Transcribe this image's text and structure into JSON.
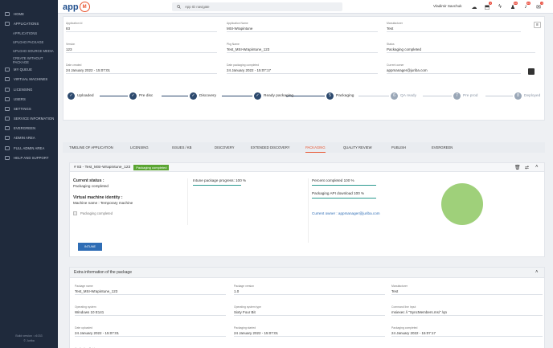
{
  "sidebar": {
    "items": [
      {
        "label": "Home",
        "icon": "home-icon"
      },
      {
        "label": "Applications",
        "icon": "apps-icon"
      },
      {
        "label": "Applications",
        "sub": true
      },
      {
        "label": "Upload package",
        "sub": true
      },
      {
        "label": "Upload source media",
        "sub": true
      },
      {
        "label": "Create without package",
        "sub": true
      },
      {
        "label": "My queue",
        "icon": "queue-icon"
      },
      {
        "label": "Virtual machines",
        "icon": "vm-icon"
      },
      {
        "label": "Licensing",
        "icon": "key-icon"
      },
      {
        "label": "Users",
        "icon": "users-icon"
      },
      {
        "label": "Settings",
        "icon": "gear-icon"
      },
      {
        "label": "Service information",
        "icon": "info-icon"
      },
      {
        "label": "Evergreen",
        "icon": "leaf-icon"
      },
      {
        "label": "Admin area",
        "icon": "admin-icon"
      },
      {
        "label": "Full admin area",
        "icon": "admin-icon"
      },
      {
        "label": "Help and support",
        "icon": "help-icon"
      }
    ],
    "footer_line1": "Build version : v1033",
    "footer_line2": "© Juriba"
  },
  "topbar": {
    "logo_text": "app",
    "logo_badge": "M",
    "search_placeholder": "App ID navigate",
    "user_name": "Vladimir Savchuk",
    "badges": [
      "",
      "1",
      "",
      "10",
      "10",
      "1"
    ]
  },
  "fields_top": [
    {
      "label": "Application Id",
      "value": "83"
    },
    {
      "label": "Application Name",
      "value": "MSI-Wrapintune"
    },
    {
      "label": "Manufacturer",
      "value": "Test"
    },
    {
      "label": "Version",
      "value": "123"
    },
    {
      "label": "Pkg Name",
      "value": "Test_MSI-Wrapintune_123"
    },
    {
      "label": "Status",
      "value": "Packaging completed"
    },
    {
      "label": "Date created",
      "value": "24 January 2022 - 15:07:01"
    },
    {
      "label": "Date packaging completed",
      "value": "24 January 2022 - 15:07:17"
    },
    {
      "label": "Current owner",
      "value": "appmanager@juriba.com"
    }
  ],
  "steps": [
    {
      "label": "Uploaded",
      "num": "✓",
      "done": true
    },
    {
      "label": "Pre disc",
      "num": "✓",
      "done": true
    },
    {
      "label": "Discovery",
      "num": "✓",
      "done": true
    },
    {
      "label": "Ready packaging",
      "num": "✓",
      "done": true
    },
    {
      "label": "Packaging",
      "num": "5",
      "done": true
    },
    {
      "label": "QA ready",
      "num": "6",
      "done": false
    },
    {
      "label": "Pre prod",
      "num": "7",
      "done": false
    },
    {
      "label": "Deployed",
      "num": "8",
      "done": false
    }
  ],
  "tabs": [
    {
      "label": "Timeline of application"
    },
    {
      "label": "Licensing"
    },
    {
      "label": "Issues / KB"
    },
    {
      "label": "Discovery"
    },
    {
      "label": "Extended discovery"
    },
    {
      "label": "Packaging"
    },
    {
      "label": "Quality review"
    },
    {
      "label": "Publish"
    },
    {
      "label": "Evergreen"
    }
  ],
  "package_panel": {
    "title": "# 83 - Test_MSI-Wrapintune_123",
    "chip": "Packaging completed",
    "current_status_label": "Current status :",
    "current_status_value": "Packaging completed",
    "vm_identity_label": "Virtual machine identity :",
    "vm_name": "Machine name : Temporary machine",
    "checkbox_label": "Packaging completed",
    "intune_progress": "Intune package progress: 100 %",
    "percent_completed": "Percent completed 100 %",
    "api_download": "Packaging API download 100 %",
    "current_owner": "Current owner : appmanager@juriba.com",
    "button_label": "Intune",
    "progress": {
      "intune": 1.0,
      "percent": 1.0,
      "api": 1.0
    },
    "pie_color": "#9fd07a"
  },
  "extra": {
    "title": "Extra information of the package",
    "fields": [
      {
        "label": "Package name",
        "value": "Test_MSI-Wrapintune_123"
      },
      {
        "label": "Package version",
        "value": "1.0"
      },
      {
        "label": "Manufacturer",
        "value": "Test"
      },
      {
        "label": "Operating system",
        "value": "Windows 10 E141"
      },
      {
        "label": "Operating system type",
        "value": "Sixty Four Bit"
      },
      {
        "label": "Command line Input",
        "value": "msiexec /i \"SyncMembers.msi\" /qn"
      },
      {
        "label": "Date uploaded",
        "value": "24 January 2022 - 15:07:01"
      },
      {
        "label": "Packaging started",
        "value": "24 January 2022 - 15:07:01"
      },
      {
        "label": "Packaging completed",
        "value": "24 January 2022 - 15:07:17"
      },
      {
        "label": "Application Guid",
        "value": "c975ed81-9a6e-4528-88d8-6fbaed25c153"
      }
    ]
  }
}
